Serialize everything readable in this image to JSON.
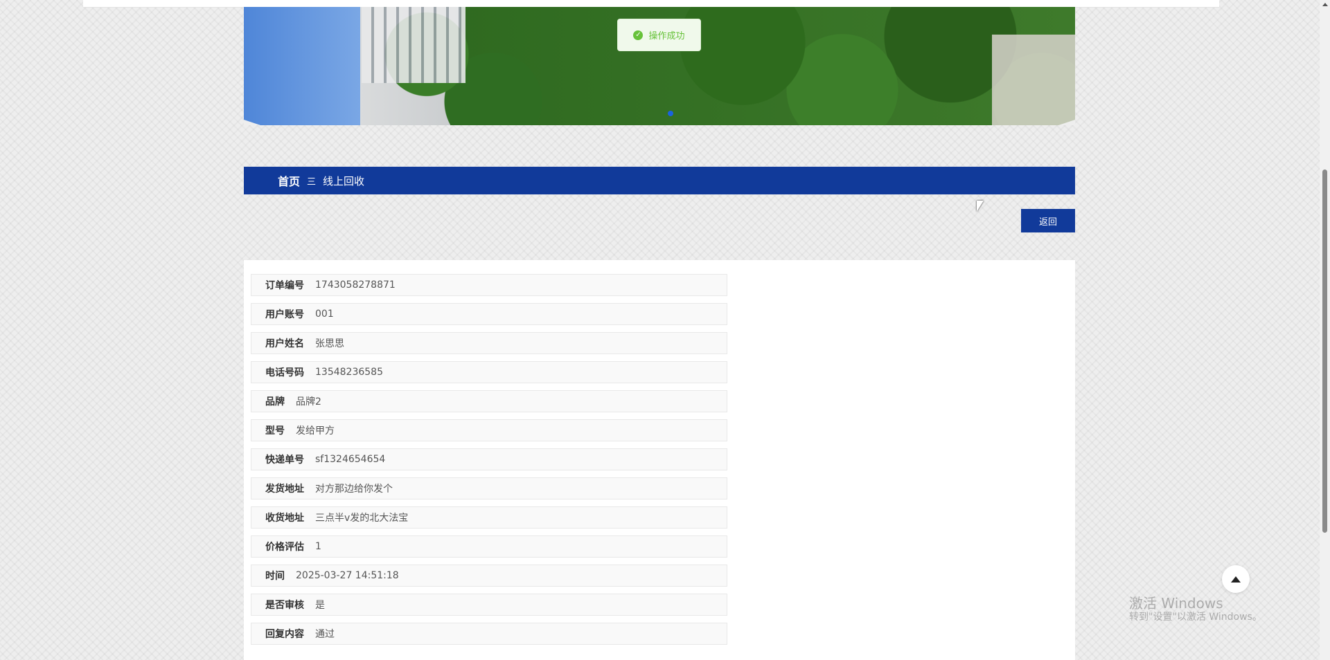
{
  "toast": {
    "message": "操作成功",
    "icon": "check-circle-icon",
    "color": "#67c23a"
  },
  "breadcrumb": {
    "home": "首页",
    "separator": "三",
    "current": "线上回收"
  },
  "actions": {
    "back_label": "返回"
  },
  "details": [
    {
      "label": "订单编号",
      "value": "1743058278871"
    },
    {
      "label": "用户账号",
      "value": "001"
    },
    {
      "label": "用户姓名",
      "value": "张思思"
    },
    {
      "label": "电话号码",
      "value": "13548236585"
    },
    {
      "label": "品牌",
      "value": "品牌2"
    },
    {
      "label": "型号",
      "value": "发给甲方"
    },
    {
      "label": "快递单号",
      "value": "sf1324654654"
    },
    {
      "label": "发货地址",
      "value": "对方那边给你发个"
    },
    {
      "label": "收货地址",
      "value": "三点半v发的北大法宝"
    },
    {
      "label": "价格评估",
      "value": "1"
    },
    {
      "label": "时间",
      "value": "2025-03-27 14:51:18"
    },
    {
      "label": "是否审核",
      "value": "是"
    },
    {
      "label": "回复内容",
      "value": "通过"
    }
  ],
  "watermark": {
    "title": "激活 Windows",
    "subtitle": "转到\"设置\"以激活 Windows。"
  },
  "colors": {
    "primary": "#113a9a",
    "success": "#67c23a"
  }
}
